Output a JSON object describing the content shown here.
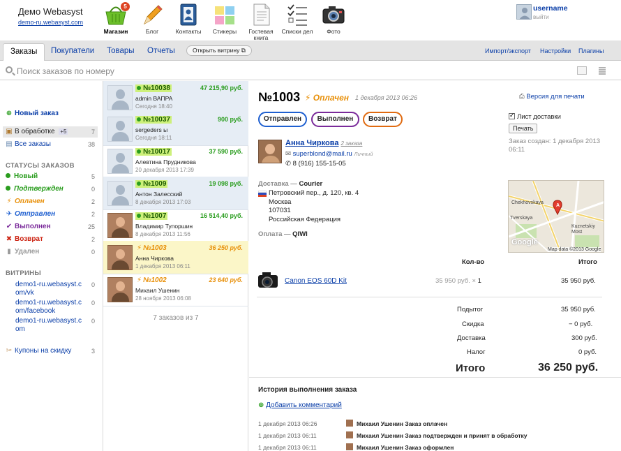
{
  "header": {
    "brand": "Демо Webasyst",
    "brand_url": "demo-ru.webasyst.com",
    "apps": [
      {
        "label": "Магазин",
        "icon": "shop-basket-icon",
        "badge": "5",
        "active": true
      },
      {
        "label": "Блог",
        "icon": "pencil-icon"
      },
      {
        "label": "Контакты",
        "icon": "contacts-book-icon"
      },
      {
        "label": "Стикеры",
        "icon": "stickers-icon"
      },
      {
        "label": "Гостевая книга",
        "icon": "guestbook-icon"
      },
      {
        "label": "Списки дел",
        "icon": "checklist-icon"
      },
      {
        "label": "Фото",
        "icon": "camera-icon"
      }
    ],
    "user": {
      "name": "username",
      "logout": "выйти"
    }
  },
  "nav": {
    "tabs": [
      "Заказы",
      "Покупатели",
      "Товары",
      "Отчеты"
    ],
    "storefront": "Открыть витрину",
    "right": [
      "Импорт/экспорт",
      "Настройки",
      "Плагины"
    ]
  },
  "search": {
    "placeholder": "Поиск заказов по номеру"
  },
  "sidebar": {
    "new_order": "Новый заказ",
    "processing": {
      "label": "В обработке",
      "badge": "+5",
      "count": "7"
    },
    "all_orders": {
      "label": "Все заказы",
      "count": "38"
    },
    "statuses_title": "СТАТУСЫ ЗАКАЗОВ",
    "statuses": [
      {
        "label": "Новый",
        "count": "5",
        "color": "#2a9d1e"
      },
      {
        "label": "Подтвержден",
        "count": "0",
        "color": "#2a9d1e"
      },
      {
        "label": "Оплачен",
        "count": "2",
        "color": "#e8900a"
      },
      {
        "label": "Отправлен",
        "count": "2",
        "color": "#1e5fd0"
      },
      {
        "label": "Выполнен",
        "count": "25",
        "color": "#7a2a9a"
      },
      {
        "label": "Возврат",
        "count": "2",
        "color": "#cc2211"
      },
      {
        "label": "Удален",
        "count": "0",
        "color": "#999999"
      }
    ],
    "stores_title": "ВИТРИНЫ",
    "stores": [
      {
        "label": "demo1-ru.webasyst.com/vk",
        "count": "0"
      },
      {
        "label": "demo1-ru.webasyst.com/facebook",
        "count": "0"
      },
      {
        "label": "demo1-ru.webasyst.com",
        "count": "0"
      }
    ],
    "coupons": {
      "label": "Купоны на скидку",
      "count": "3"
    }
  },
  "orders": [
    {
      "num": "№10038",
      "amount": "47 215,90 руб.",
      "customer": "admin ВАПРА",
      "date": "Сегодня 18:40",
      "status": "new"
    },
    {
      "num": "№10037",
      "amount": "900 руб.",
      "customer": "sergeders ы",
      "date": "Сегодня 18:11",
      "status": "new"
    },
    {
      "num": "№10017",
      "amount": "37 590 руб.",
      "customer": "Алевтина Прудникова",
      "date": "20 декабря 2013 17:39",
      "status": "new"
    },
    {
      "num": "№1009",
      "amount": "19 098 руб.",
      "customer": "Антон Залесский",
      "date": "8 декабря 2013 17:03",
      "status": "new"
    },
    {
      "num": "№1007",
      "amount": "16 514,40 руб.",
      "customer": "Владимир Тупоршин",
      "date": "8 декабря 2013 11:56",
      "status": "new",
      "photo": true
    },
    {
      "num": "№1003",
      "amount": "36 250 руб.",
      "customer": "Анна Чиркова",
      "date": "1 декабря 2013 06:11",
      "status": "paid",
      "photo": true,
      "selected": true
    },
    {
      "num": "№1002",
      "amount": "23 640 руб.",
      "customer": "Михаил Ушенин",
      "date": "28 ноября 2013 06:08",
      "status": "paid",
      "photo": true
    }
  ],
  "orders_footer": "7 заказов из 7",
  "detail": {
    "title": "№1003",
    "status": "Оплачен",
    "date": "1 декабря 2013 06:26",
    "actions": [
      {
        "label": "Отправлен",
        "color": "#1e5fd0"
      },
      {
        "label": "Выполнен",
        "color": "#7a2a9a"
      },
      {
        "label": "Возврат",
        "color": "#e06a10"
      }
    ],
    "print_link": "Версия для печати",
    "packing_list": "Лист доставки",
    "print_button": "Печать",
    "created": "Заказ создан: 1 декабря 2013 06:11",
    "customer": {
      "name": "Анна Чиркова",
      "orders": "2 заказа",
      "email": "superblond@mail.ru",
      "email_type": "Личный",
      "phone": "8 (916) 155-15-05"
    },
    "shipping_label": "Доставка —",
    "shipping_method": "Courier",
    "address": [
      "Петровский пер., д. 120, кв. 4",
      "Москва",
      "107031",
      "Российская Федерация"
    ],
    "payment_label": "Оплата —",
    "payment_method": "QIWI",
    "map_labels": [
      "Chekhovskaya",
      "Tverskaya",
      "Kuznetskiy Most",
      "Google",
      "Map data ©2013 Google"
    ],
    "table_head": {
      "qty": "Кол-во",
      "total": "Итого"
    },
    "item": {
      "name": "Canon EOS 60D Kit",
      "price": "35 950 руб.",
      "qty": "1",
      "total": "35 950 руб."
    },
    "summary": [
      {
        "label": "Подытог",
        "value": "35 950 руб."
      },
      {
        "label": "Скидка",
        "value": "− 0 руб."
      },
      {
        "label": "Доставка",
        "value": "300 руб."
      },
      {
        "label": "Налог",
        "value": "0 руб."
      }
    ],
    "grand_label": "Итого",
    "grand_value": "36 250 руб.",
    "history_title": "История выполнения заказа",
    "add_comment": "Добавить комментарий",
    "history": [
      {
        "date": "1 декабря 2013 06:26",
        "text": "Михаил Ушенин Заказ оплачен"
      },
      {
        "date": "1 декабря 2013 06:11",
        "text": "Михаил Ушенин Заказ подтвержден и принят в обработку"
      },
      {
        "date": "1 декабря 2013 06:11",
        "text": "Михаил Ушенин Заказ оформлен"
      }
    ]
  }
}
